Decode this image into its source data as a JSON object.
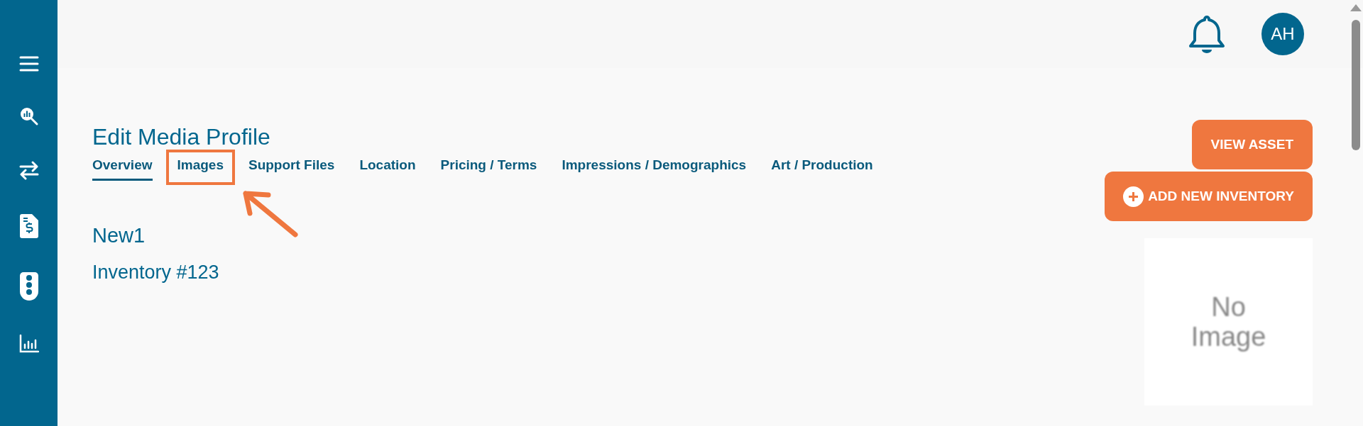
{
  "header": {
    "avatar": "AH"
  },
  "page": {
    "title": "Edit Media Profile"
  },
  "tabs": [
    {
      "label": "Overview",
      "selected": true,
      "highlighted": false
    },
    {
      "label": "Images",
      "selected": false,
      "highlighted": true
    },
    {
      "label": "Support Files",
      "selected": false,
      "highlighted": false
    },
    {
      "label": "Location",
      "selected": false,
      "highlighted": false
    },
    {
      "label": "Pricing / Terms",
      "selected": false,
      "highlighted": false
    },
    {
      "label": "Impressions / Demographics",
      "selected": false,
      "highlighted": false
    },
    {
      "label": "Art / Production",
      "selected": false,
      "highlighted": false
    }
  ],
  "actions": [
    {
      "label": "VIEW ASSET",
      "kind": "plain"
    },
    {
      "label": "ADD NEW INVENTORY",
      "kind": "add"
    }
  ],
  "media": {
    "name": "New1",
    "inventory": "Inventory #123"
  },
  "image_placeholder": "No Image"
}
